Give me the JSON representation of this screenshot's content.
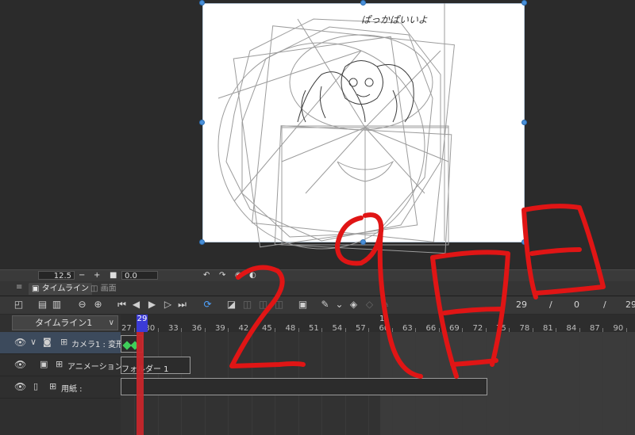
{
  "canvas": {
    "paper_note": "ぱっかぱいいよ"
  },
  "view_strip": {
    "zoom_value": "12.5",
    "minus_label": "−",
    "plus_label": "+",
    "rotation_value": "0.0"
  },
  "panel": {
    "tabs": [
      {
        "label": "タイムライン"
      },
      {
        "label": "画面"
      }
    ]
  },
  "toolbar": {
    "current_frame": "29",
    "slash1": "/",
    "end_frame": "0",
    "slash2": "/",
    "total_frame": "29"
  },
  "timeline": {
    "selector_value": "タイムライン1",
    "playhead_frame": "29",
    "ruler_marker": "1",
    "ticks": [
      "27",
      "30",
      "33",
      "36",
      "39",
      "42",
      "45",
      "48",
      "51",
      "54",
      "57",
      "60",
      "63",
      "66",
      "69",
      "72",
      "75",
      "78",
      "81",
      "84",
      "87",
      "90"
    ]
  },
  "layers": [
    {
      "name": "カメラ1 : 変形",
      "track_label": ""
    },
    {
      "name": "アニメーションフォル",
      "track_label": "フォルダー 1"
    },
    {
      "name": "用紙 :",
      "track_label": ""
    }
  ],
  "colors": {
    "playhead": "#3b3bd6",
    "frame_highlight": "#c7262b",
    "keyframe": "#3fcf5a",
    "handwriting": "#e01515",
    "selection": "#4a90d9"
  }
}
